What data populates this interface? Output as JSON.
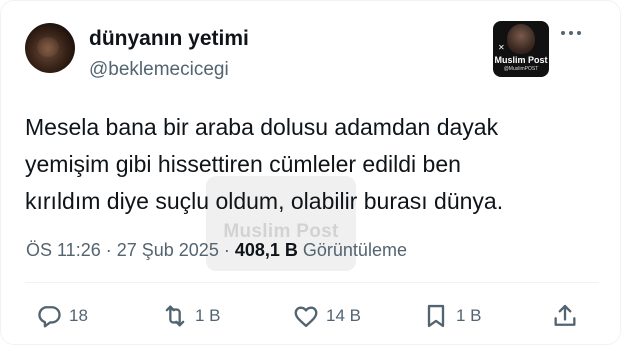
{
  "user": {
    "display_name": "dünyanın yetimi",
    "handle": "@beklemecicegi"
  },
  "badge": {
    "brand": "Muslim Post",
    "sub": "@MuslimPOST"
  },
  "tweet": {
    "lines": [
      "Mesela bana bir araba dolusu adamdan dayak",
      "yemişim gibi hissettiren cümleler edildi ben",
      "kırıldım diye suçlu oldum, olabilir burası dünya."
    ]
  },
  "meta": {
    "time": "ÖS 11:26",
    "date": "27 Şub 2025",
    "views_count": "408,1 B",
    "views_label": "Görüntüleme"
  },
  "watermark": {
    "text": "Muslim Post"
  },
  "actions": {
    "reply_count": "18",
    "retweet_count": "1 B",
    "like_count": "14 B",
    "bookmark_count": "1 B"
  },
  "icons": [
    "reply-icon",
    "retweet-icon",
    "like-icon",
    "bookmark-icon",
    "share-icon",
    "more-icon"
  ],
  "colors": {
    "text": "#0f1419",
    "secondary": "#536471",
    "divider": "#eff3f4"
  }
}
